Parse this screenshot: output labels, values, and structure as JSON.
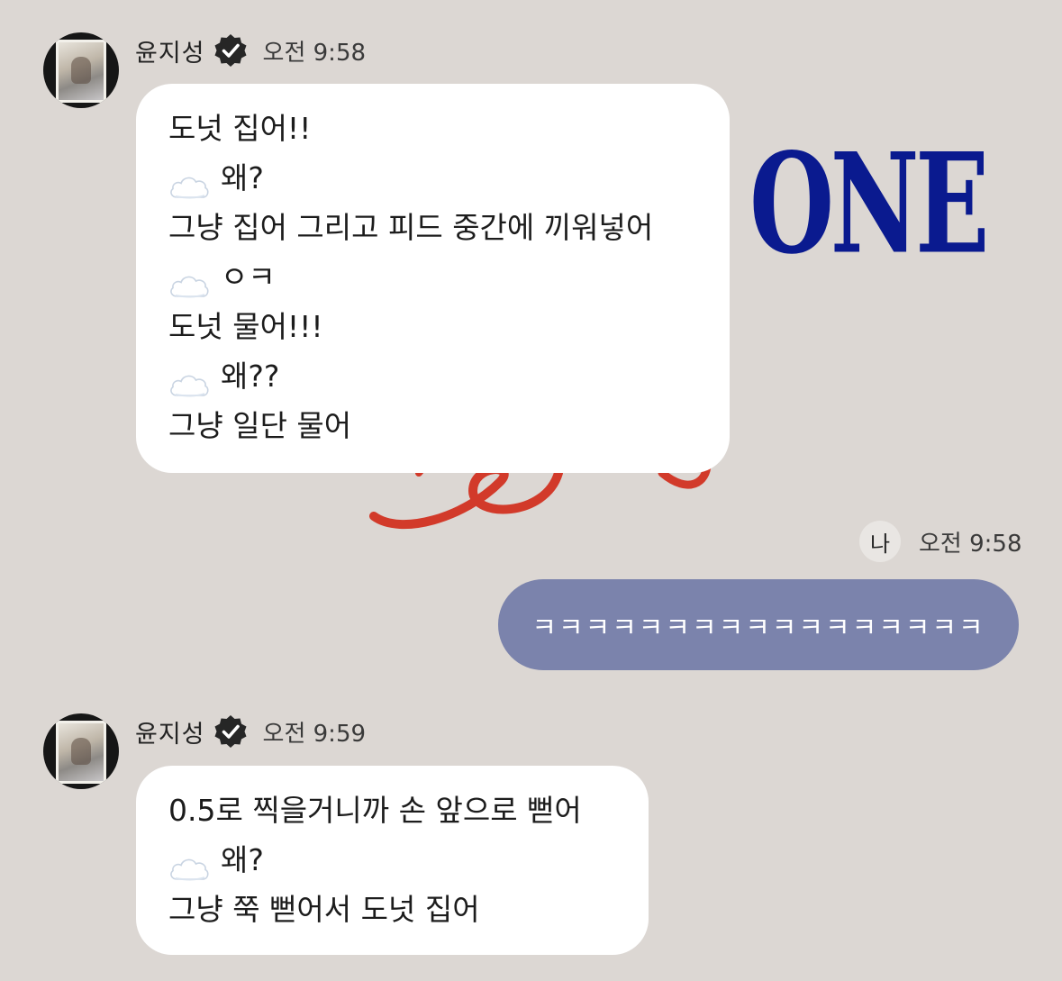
{
  "background": {
    "color": "#dcd7d3",
    "wordmark": "ONE",
    "wordmark_color": "#0a1a8f",
    "script_color": "#d23a2a"
  },
  "messages": [
    {
      "sender": "윤지성",
      "time": "오전 9:58",
      "verified": true,
      "lines": [
        {
          "cloud": false,
          "text": "도넛 집어!!"
        },
        {
          "cloud": true,
          "text": "왜?"
        },
        {
          "cloud": false,
          "text": "그냥 집어 그리고 피드 중간에 끼워넣어"
        },
        {
          "cloud": true,
          "text": "ㅇㅋ"
        },
        {
          "cloud": false,
          "text": "도넛 물어!!!"
        },
        {
          "cloud": true,
          "text": "왜??"
        },
        {
          "cloud": false,
          "text": "그냥 일단 물어"
        }
      ]
    },
    {
      "sender": "윤지성",
      "time": "오전 9:59",
      "verified": true,
      "lines": [
        {
          "cloud": false,
          "text": "0.5로 찍을거니까 손 앞으로 뻗어"
        },
        {
          "cloud": true,
          "text": "왜?"
        },
        {
          "cloud": false,
          "text": "그냥 쭉 뻗어서 도넛 집어"
        }
      ]
    }
  ],
  "my_message": {
    "tag": "나",
    "time": "오전 9:58",
    "text": "ㅋㅋㅋㅋㅋㅋㅋㅋㅋㅋㅋㅋㅋㅋㅋㅋㅋ",
    "bubble_color": "#7b83ac"
  },
  "icons": {
    "verified": "verified-check-icon",
    "cloud": "cloud-emoji-icon"
  }
}
